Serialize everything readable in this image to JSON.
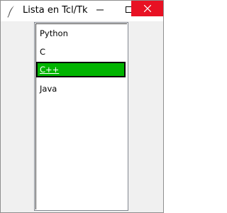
{
  "window": {
    "title": "Lista en Tcl/Tk",
    "icon": "feather-icon",
    "close_color": "#e81123"
  },
  "listbox": {
    "items": [
      "Python",
      "C",
      "C++",
      "Java"
    ],
    "selected_index": 2,
    "selected_color": "#00b400"
  }
}
